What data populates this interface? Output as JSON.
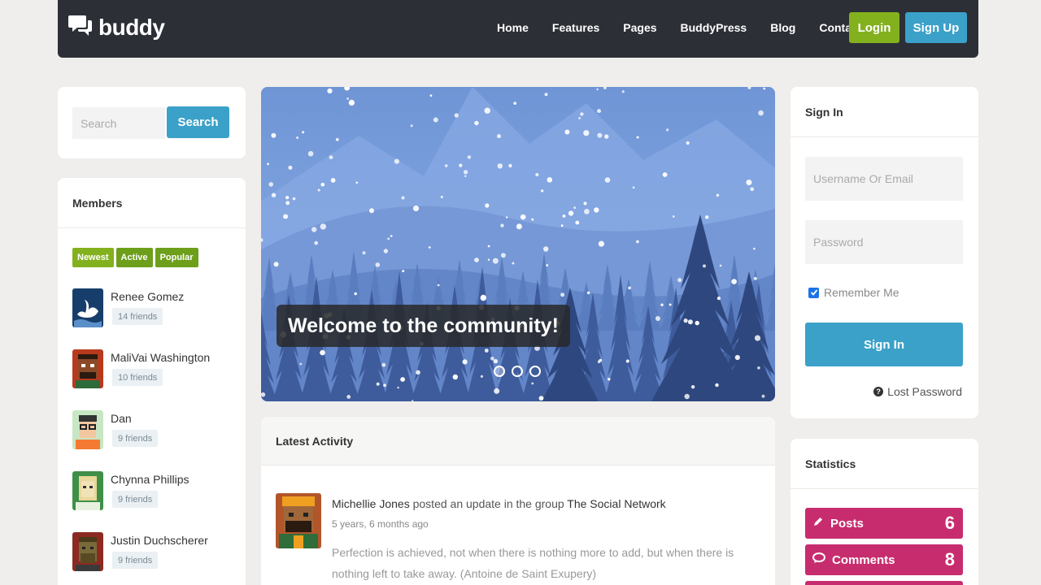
{
  "brand": {
    "name": "buddy"
  },
  "nav": {
    "links": [
      "Home",
      "Features",
      "Pages",
      "BuddyPress",
      "Blog",
      "Contact"
    ],
    "login_label": "Login",
    "signup_label": "Sign Up"
  },
  "search": {
    "placeholder": "Search",
    "button_label": "Search"
  },
  "members": {
    "title": "Members",
    "filters": [
      "Newest",
      "Active",
      "Popular"
    ],
    "list": [
      {
        "name": "Renee Gomez",
        "friends": "14 friends"
      },
      {
        "name": "MaliVai Washington",
        "friends": "10 friends"
      },
      {
        "name": "Dan",
        "friends": "9 friends"
      },
      {
        "name": "Chynna Phillips",
        "friends": "9 friends"
      },
      {
        "name": "Justin Duchscherer",
        "friends": "9 friends"
      }
    ]
  },
  "slider": {
    "caption": "Welcome to the community!",
    "slide_count": 3,
    "active_slide": 1
  },
  "activity": {
    "title": "Latest Activity",
    "item": {
      "user": "Michellie Jones",
      "action": " posted an update in the group ",
      "group": "The Social Network",
      "time": "5 years, 6 months ago",
      "text": "Perfection is achieved, not when there is nothing more to add, but when there is nothing left to take away. (Antoine de Saint Exupery)"
    }
  },
  "signin": {
    "title": "Sign In",
    "username_placeholder": "Username Or Email",
    "password_placeholder": "Password",
    "remember_label": "Remember Me",
    "remember_checked": true,
    "button_label": "Sign In",
    "lost_password": "Lost Password"
  },
  "stats": {
    "title": "Statistics",
    "items": [
      {
        "label": "Posts",
        "value": "6",
        "icon": "pencil-icon"
      },
      {
        "label": "Comments",
        "value": "8",
        "icon": "comment-icon"
      }
    ]
  },
  "colors": {
    "navbar": "#2c2f36",
    "green": "#83b11e",
    "blue": "#3ba1c8",
    "stat_pink": "#c72d6e"
  }
}
